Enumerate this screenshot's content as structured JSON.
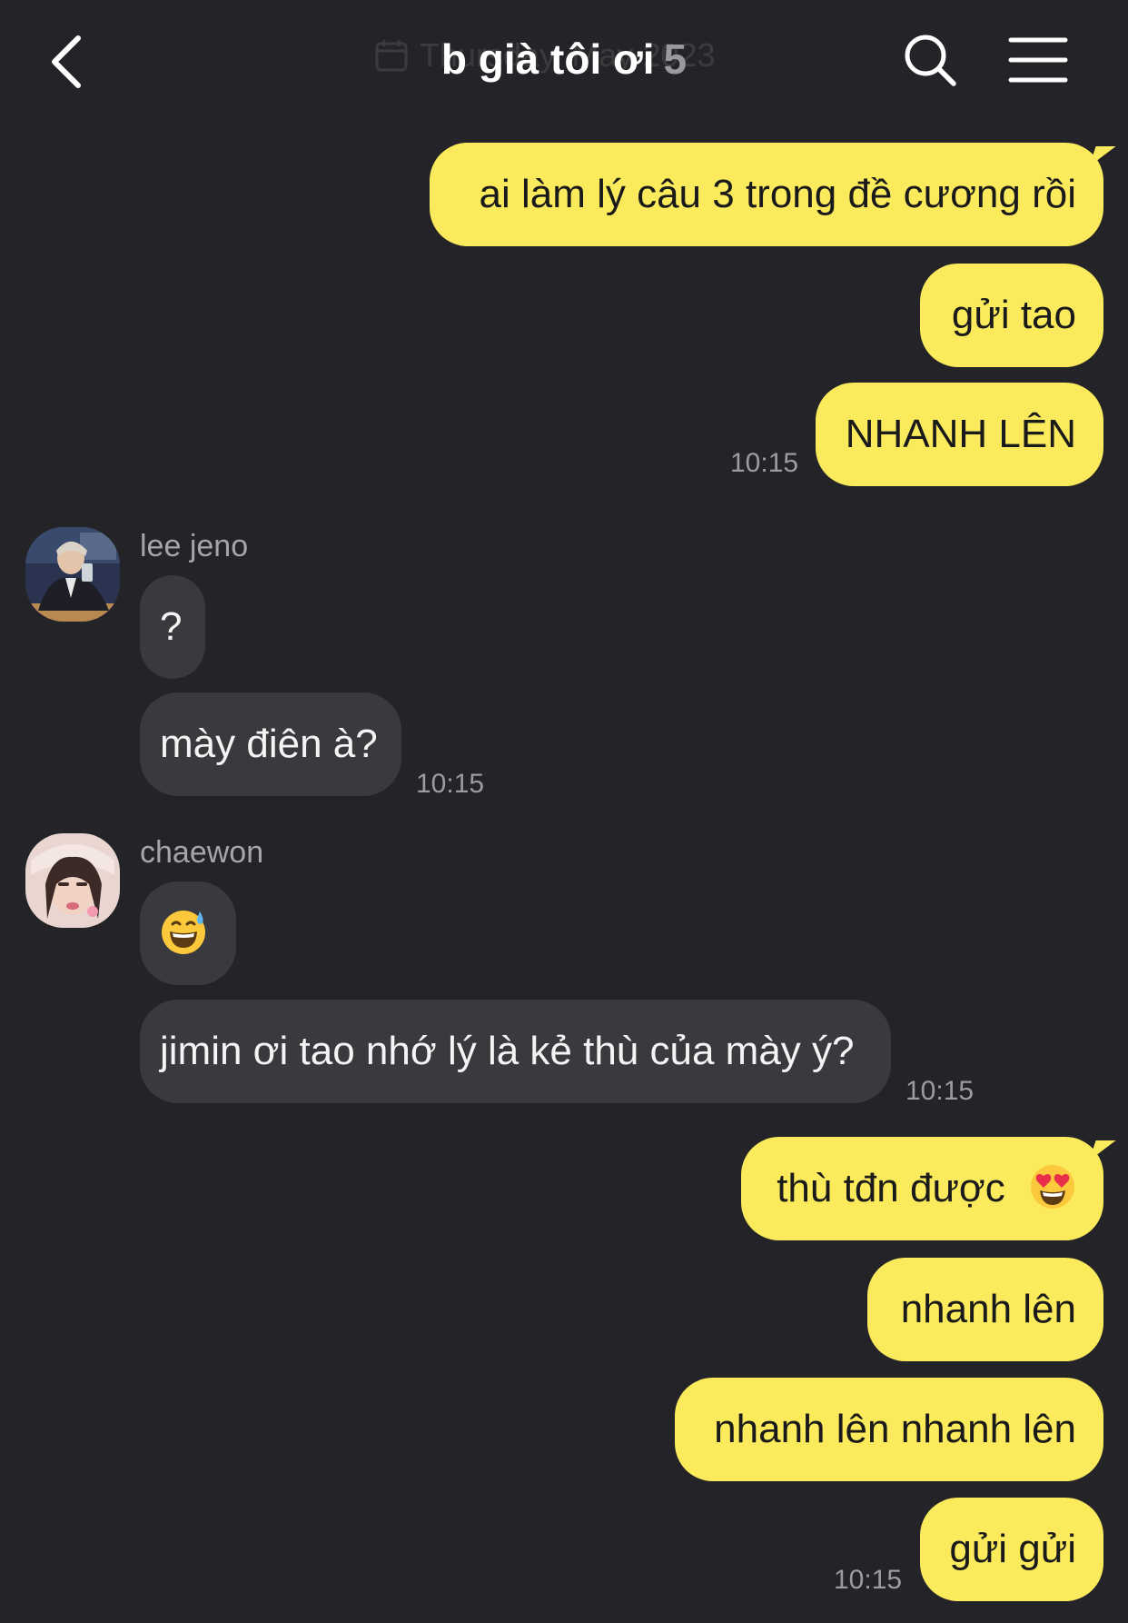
{
  "header": {
    "title": "b già tôi ơi",
    "member_count": "5",
    "date_ghost": "Thursday, May 2023",
    "back_icon": "chevron-left-icon",
    "search_icon": "search-icon",
    "menu_icon": "hamburger-menu-icon"
  },
  "colors": {
    "background": "#242428",
    "outgoing_bubble": "#fbeb5c",
    "incoming_bubble": "#3a3a3e",
    "muted_text": "#9b9ba0"
  },
  "messages": {
    "m1": {
      "text": "ai làm lý câu 3 trong đề cương rồi"
    },
    "m2": {
      "text": "gửi tao"
    },
    "m3": {
      "text": "NHANH LÊN",
      "time": "10:15"
    },
    "m4": {
      "sender": "lee jeno",
      "text": "?"
    },
    "m5": {
      "text": "mày điên à?",
      "time": "10:15"
    },
    "m6": {
      "sender": "chaewon",
      "emoji": "sweat-smile-emoji"
    },
    "m7": {
      "text": "jimin ơi tao nhớ lý là kẻ thù của mày ý?",
      "time": "10:15"
    },
    "m8": {
      "text": "thù tđn được",
      "emoji": "heart-eyes-emoji"
    },
    "m9": {
      "text": "nhanh lên"
    },
    "m10": {
      "text": "nhanh lên nhanh lên"
    },
    "m11": {
      "text": "gửi gửi",
      "time": "10:15"
    }
  }
}
